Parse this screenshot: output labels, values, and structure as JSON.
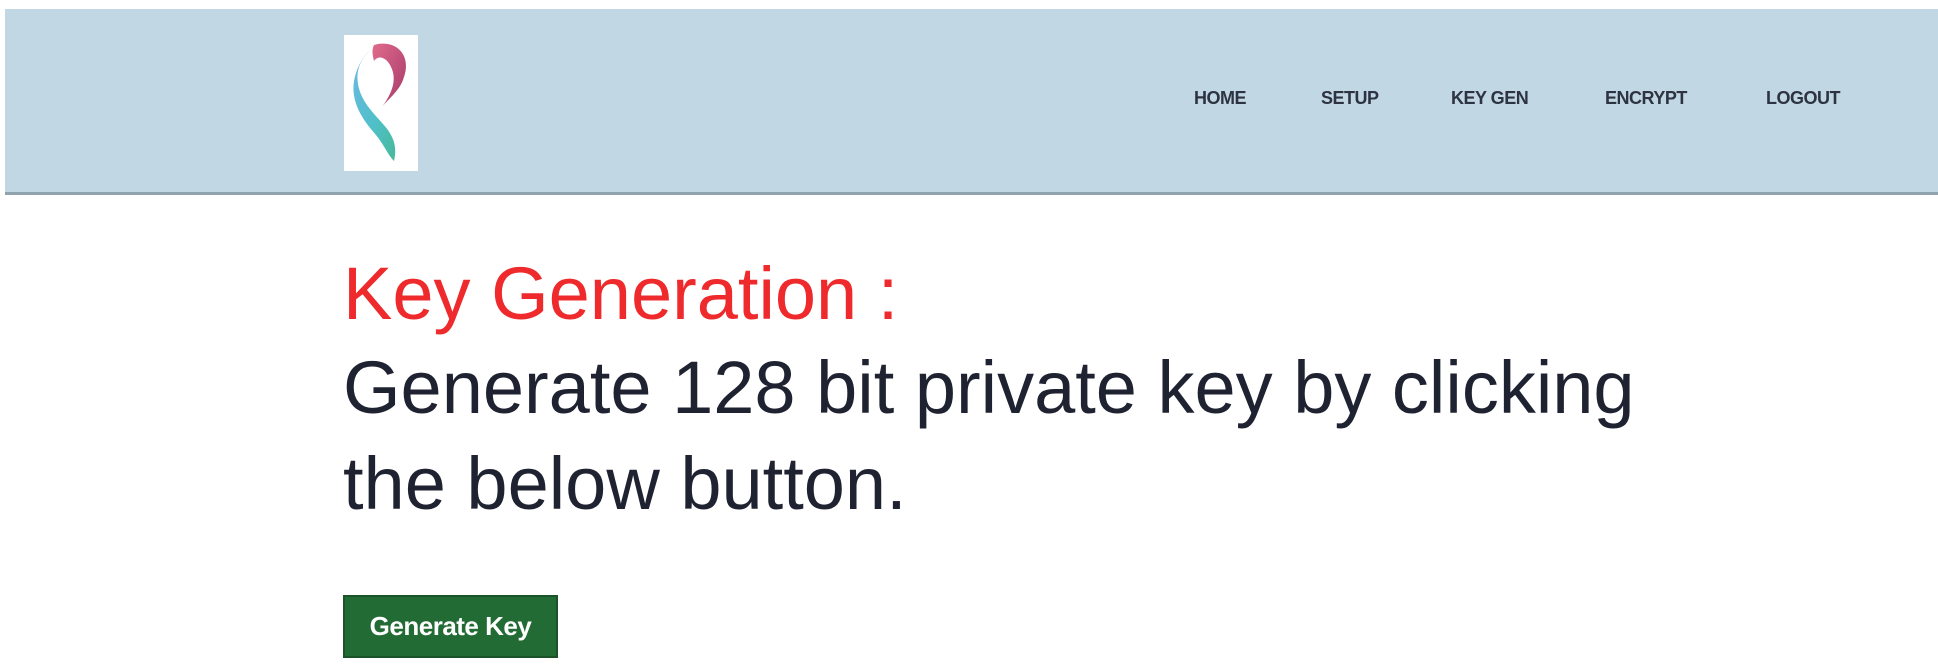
{
  "navbar": {
    "logo_icon": "stylized-swoosh-logo-icon",
    "items": [
      {
        "label": "HOME"
      },
      {
        "label": "SETUP"
      },
      {
        "label": "KEY GEN"
      },
      {
        "label": "ENCRYPT"
      },
      {
        "label": "LOGOUT"
      }
    ],
    "background_color": "#c2d7e4"
  },
  "main": {
    "heading": "Key Generation :",
    "description": "Generate 128 bit private key by clicking the below button.",
    "button_label": "Generate Key",
    "heading_color": "#ee2a2c",
    "button_color": "#226b34"
  }
}
